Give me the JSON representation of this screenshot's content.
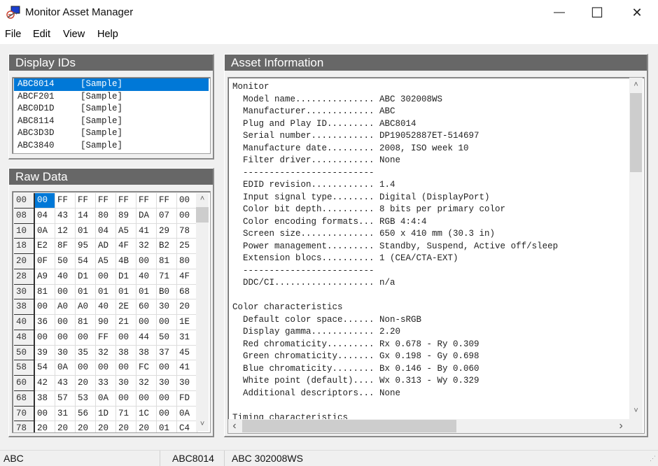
{
  "window": {
    "title": "Monitor Asset Manager",
    "icons": {
      "app": "monitor-app-icon",
      "minimize": "minimize-icon",
      "maximize": "maximize-icon",
      "close": "close-icon"
    },
    "minimize_glyph": "—",
    "maximize_glyph": "☐",
    "close_glyph": "✕"
  },
  "menu": [
    "File",
    "Edit",
    "View",
    "Help"
  ],
  "display_ids": {
    "header": "Display IDs",
    "items": [
      {
        "id": "ABC8014",
        "tag": "[Sample]",
        "selected": true
      },
      {
        "id": "ABCF201",
        "tag": "[Sample]",
        "selected": false
      },
      {
        "id": "ABC0D1D",
        "tag": "[Sample]",
        "selected": false
      },
      {
        "id": "ABC8114",
        "tag": "[Sample]",
        "selected": false
      },
      {
        "id": "ABC3D3D",
        "tag": "[Sample]",
        "selected": false
      },
      {
        "id": "ABC3840",
        "tag": "[Sample]",
        "selected": false
      }
    ]
  },
  "raw_data": {
    "header": "Raw Data",
    "selected_cell": {
      "row": 0,
      "col": 0
    },
    "rows": [
      {
        "offset": "00",
        "bytes": [
          "00",
          "FF",
          "FF",
          "FF",
          "FF",
          "FF",
          "FF",
          "00"
        ]
      },
      {
        "offset": "08",
        "bytes": [
          "04",
          "43",
          "14",
          "80",
          "89",
          "DA",
          "07",
          "00"
        ]
      },
      {
        "offset": "10",
        "bytes": [
          "0A",
          "12",
          "01",
          "04",
          "A5",
          "41",
          "29",
          "78"
        ]
      },
      {
        "offset": "18",
        "bytes": [
          "E2",
          "8F",
          "95",
          "AD",
          "4F",
          "32",
          "B2",
          "25"
        ]
      },
      {
        "offset": "20",
        "bytes": [
          "0F",
          "50",
          "54",
          "A5",
          "4B",
          "00",
          "81",
          "80"
        ]
      },
      {
        "offset": "28",
        "bytes": [
          "A9",
          "40",
          "D1",
          "00",
          "D1",
          "40",
          "71",
          "4F"
        ]
      },
      {
        "offset": "30",
        "bytes": [
          "81",
          "00",
          "01",
          "01",
          "01",
          "01",
          "B0",
          "68"
        ]
      },
      {
        "offset": "38",
        "bytes": [
          "00",
          "A0",
          "A0",
          "40",
          "2E",
          "60",
          "30",
          "20"
        ]
      },
      {
        "offset": "40",
        "bytes": [
          "36",
          "00",
          "81",
          "90",
          "21",
          "00",
          "00",
          "1E"
        ]
      },
      {
        "offset": "48",
        "bytes": [
          "00",
          "00",
          "00",
          "FF",
          "00",
          "44",
          "50",
          "31"
        ]
      },
      {
        "offset": "50",
        "bytes": [
          "39",
          "30",
          "35",
          "32",
          "38",
          "38",
          "37",
          "45"
        ]
      },
      {
        "offset": "58",
        "bytes": [
          "54",
          "0A",
          "00",
          "00",
          "00",
          "FC",
          "00",
          "41"
        ]
      },
      {
        "offset": "60",
        "bytes": [
          "42",
          "43",
          "20",
          "33",
          "30",
          "32",
          "30",
          "30"
        ]
      },
      {
        "offset": "68",
        "bytes": [
          "38",
          "57",
          "53",
          "0A",
          "00",
          "00",
          "00",
          "FD"
        ]
      },
      {
        "offset": "70",
        "bytes": [
          "00",
          "31",
          "56",
          "1D",
          "71",
          "1C",
          "00",
          "0A"
        ]
      },
      {
        "offset": "78",
        "bytes": [
          "20",
          "20",
          "20",
          "20",
          "20",
          "20",
          "01",
          "C4"
        ]
      }
    ],
    "scroll_up_glyph": "˄",
    "scroll_down_glyph": "˅"
  },
  "asset_info": {
    "header": "Asset Information",
    "lines": [
      "Monitor",
      "  Model name............... ABC 302008WS",
      "  Manufacturer............. ABC",
      "  Plug and Play ID......... ABC8014",
      "  Serial number............ DP19052887ET-514697",
      "  Manufacture date......... 2008, ISO week 10",
      "  Filter driver............ None",
      "  -------------------------",
      "  EDID revision............ 1.4",
      "  Input signal type........ Digital (DisplayPort)",
      "  Color bit depth.......... 8 bits per primary color",
      "  Color encoding formats... RGB 4:4:4",
      "  Screen size.............. 650 x 410 mm (30.3 in)",
      "  Power management......... Standby, Suspend, Active off/sleep",
      "  Extension blocs.......... 1 (CEA/CTA-EXT)",
      "  -------------------------",
      "  DDC/CI................... n/a",
      "",
      "Color characteristics",
      "  Default color space...... Non-sRGB",
      "  Display gamma............ 2.20",
      "  Red chromaticity......... Rx 0.678 - Ry 0.309",
      "  Green chromaticity....... Gx 0.198 - Gy 0.698",
      "  Blue chromaticity........ Bx 0.146 - By 0.060",
      "  White point (default).... Wx 0.313 - Wy 0.329",
      "  Additional descriptors... None",
      "",
      "Timing characteristics"
    ],
    "scroll_up_glyph": "˄",
    "scroll_down_glyph": "˅",
    "scroll_left_glyph": "‹",
    "scroll_right_glyph": "›"
  },
  "status": {
    "manufacturer": "ABC",
    "pnp_id": "ABC8014",
    "model": "ABC 302008WS"
  }
}
